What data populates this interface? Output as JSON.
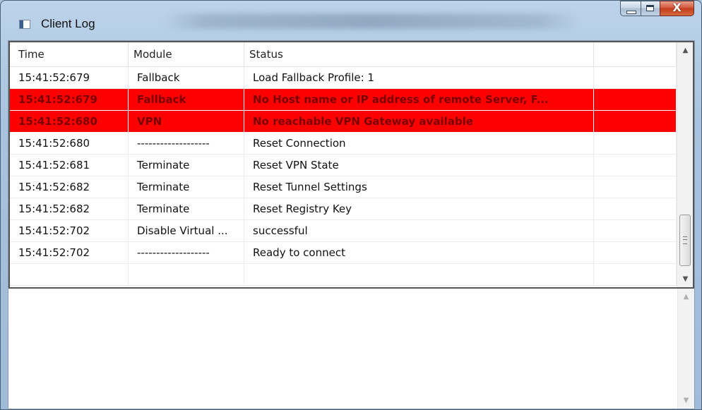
{
  "window": {
    "title": "Client Log",
    "minimize_glyph": "",
    "maximize_glyph": "",
    "close_glyph": "X"
  },
  "icons": {
    "app": "app-window-icon",
    "minimize": "minimize-icon",
    "maximize": "maximize-icon",
    "close": "close-icon",
    "scroll_up": "scroll-up-arrow-icon",
    "scroll_down": "scroll-down-arrow-icon"
  },
  "colors": {
    "error_row_bg": "#ff0000",
    "error_row_text": "#7a0000",
    "close_button": "#c33b1d"
  },
  "log": {
    "columns": [
      "Time",
      "Module",
      "Status",
      ""
    ],
    "rows": [
      {
        "time": "15:41:52:679",
        "module": "Fallback",
        "status": "Load Fallback Profile: 1",
        "level": "normal"
      },
      {
        "time": "15:41:52:679",
        "module": "Fallback",
        "status": "No Host name or IP address of remote Server, F...",
        "level": "error"
      },
      {
        "time": "15:41:52:680",
        "module": "VPN",
        "status": "No reachable VPN Gateway available",
        "level": "error"
      },
      {
        "time": "15:41:52:680",
        "module": "-------------------",
        "status": "Reset Connection",
        "level": "normal"
      },
      {
        "time": "15:41:52:681",
        "module": "Terminate",
        "status": "Reset VPN State",
        "level": "normal"
      },
      {
        "time": "15:41:52:682",
        "module": "Terminate",
        "status": "Reset Tunnel Settings",
        "level": "normal"
      },
      {
        "time": "15:41:52:682",
        "module": "Terminate",
        "status": "Reset Registry Key",
        "level": "normal"
      },
      {
        "time": "15:41:52:702",
        "module": "Disable Virtual ...",
        "status": "successful",
        "level": "normal"
      },
      {
        "time": "15:41:52:702",
        "module": "-------------------",
        "status": "Ready to connect",
        "level": "normal"
      },
      {
        "time": "",
        "module": "",
        "status": "",
        "level": "normal"
      }
    ]
  },
  "scrollbar": {
    "up_glyph": "▲",
    "down_glyph": "▼"
  }
}
